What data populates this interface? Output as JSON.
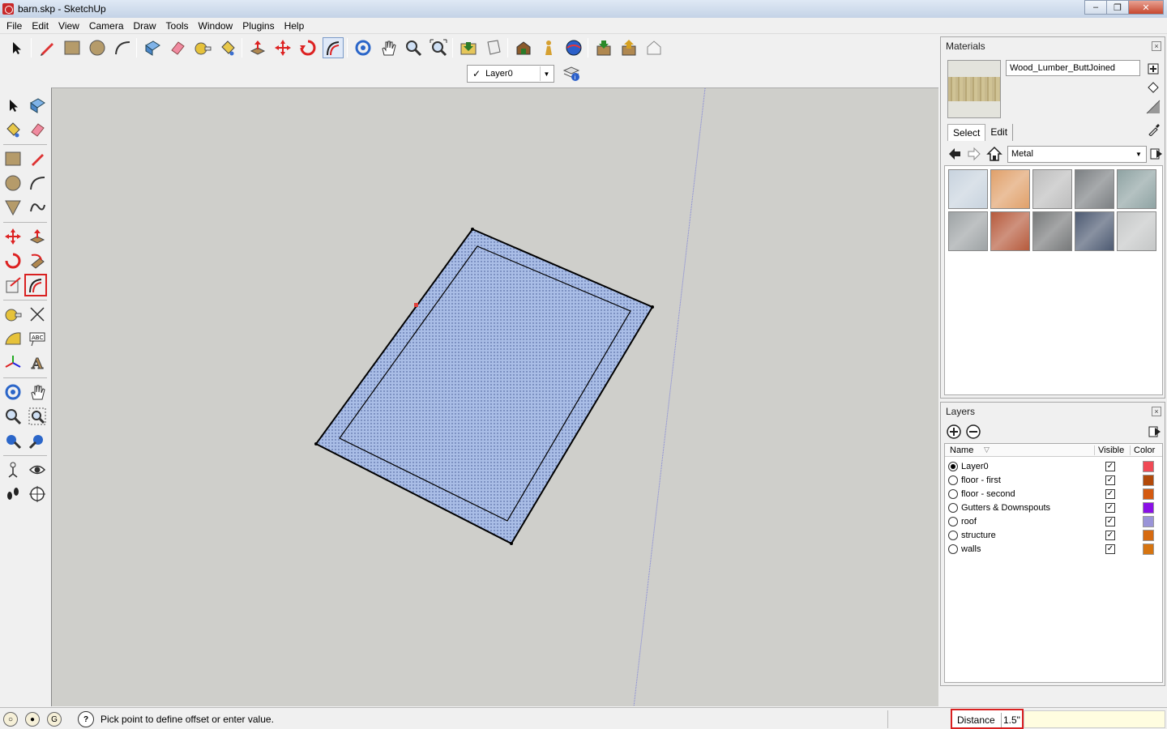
{
  "window": {
    "title": "barn.skp - SketchUp"
  },
  "menu": [
    "File",
    "Edit",
    "View",
    "Camera",
    "Draw",
    "Tools",
    "Window",
    "Plugins",
    "Help"
  ],
  "layer_toolbar": {
    "current_layer": "Layer0"
  },
  "materials": {
    "title": "Materials",
    "material_name": "Wood_Lumber_ButtJoined",
    "tabs": [
      "Select",
      "Edit"
    ],
    "library": "Metal",
    "swatch_colors": [
      "#c8d3de",
      "#e0a06a",
      "#bdbdbd",
      "#7b7f82",
      "#8fa3a3",
      "#9ea3a5",
      "#b65a3c",
      "#77797a",
      "#4d5a72",
      "#c5c7c7"
    ]
  },
  "layers": {
    "title": "Layers",
    "columns": {
      "name": "Name",
      "visible": "Visible",
      "color": "Color"
    },
    "rows": [
      {
        "name": "Layer0",
        "active": true,
        "visible": true,
        "color": "#f04a55"
      },
      {
        "name": "floor - first",
        "active": false,
        "visible": true,
        "color": "#b24a0a"
      },
      {
        "name": "floor - second",
        "active": false,
        "visible": true,
        "color": "#d45a10"
      },
      {
        "name": "Gutters & Downspouts",
        "active": false,
        "visible": true,
        "color": "#8a10e6"
      },
      {
        "name": "roof",
        "active": false,
        "visible": true,
        "color": "#9a94d8"
      },
      {
        "name": "structure",
        "active": false,
        "visible": true,
        "color": "#d66a10"
      },
      {
        "name": "walls",
        "active": false,
        "visible": true,
        "color": "#d67410"
      }
    ]
  },
  "status": {
    "hint": "Pick point to define offset or enter value.",
    "vcb_label": "Distance",
    "vcb_value": "1.5\""
  }
}
